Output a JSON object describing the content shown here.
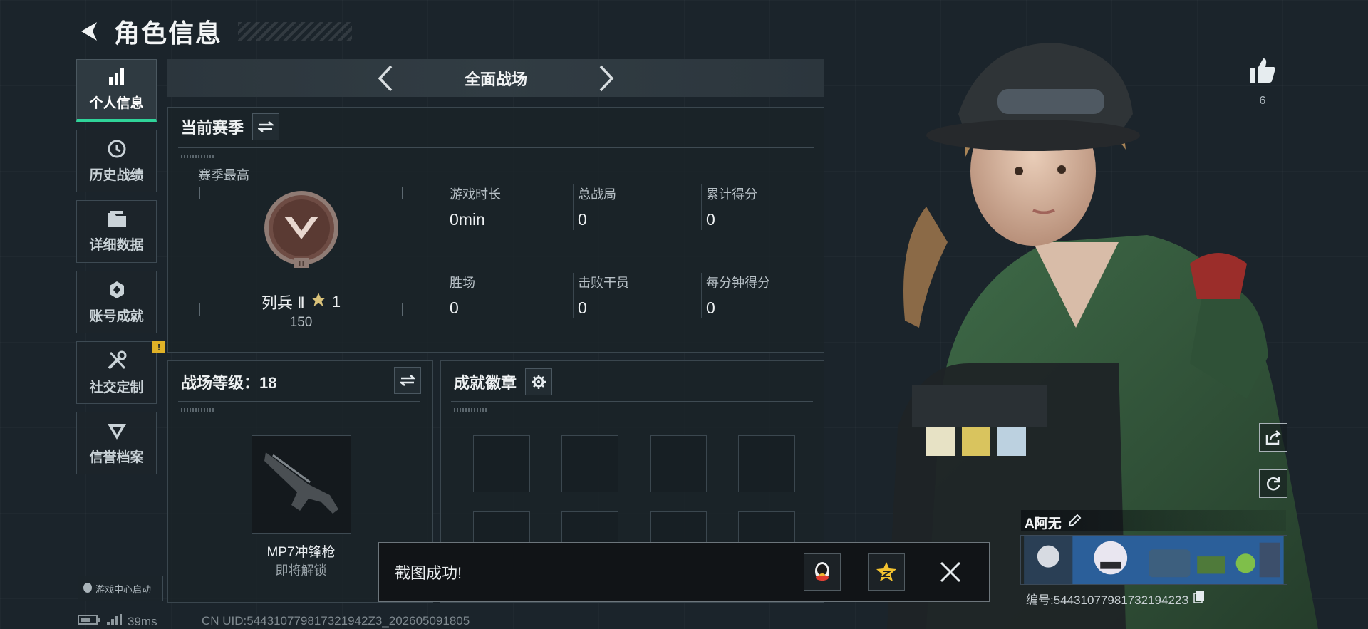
{
  "header": {
    "title": "角色信息"
  },
  "sidebar": {
    "items": [
      {
        "label": "个人信息",
        "icon": "bar-chart-icon",
        "active": true
      },
      {
        "label": "历史战绩",
        "icon": "history-icon"
      },
      {
        "label": "详细数据",
        "icon": "folder-icon"
      },
      {
        "label": "账号成就",
        "icon": "achievement-icon"
      },
      {
        "label": "社交定制",
        "icon": "tools-icon",
        "badge": "!"
      },
      {
        "label": "信誉档案",
        "icon": "reputation-icon"
      }
    ],
    "game_center": "游戏中心启动"
  },
  "mode_bar": {
    "title": "全面战场"
  },
  "season": {
    "title": "当前赛季",
    "best_label": "赛季最高",
    "rank_name": "列兵 Ⅱ",
    "rank_stars": "1",
    "rank_score": "150",
    "stats": [
      {
        "label": "游戏时长",
        "value": "0min"
      },
      {
        "label": "总战局",
        "value": "0"
      },
      {
        "label": "累计得分",
        "value": "0"
      },
      {
        "label": "胜场",
        "value": "0"
      },
      {
        "label": "击败干员",
        "value": "0"
      },
      {
        "label": "每分钟得分",
        "value": "0"
      }
    ]
  },
  "level": {
    "title": "战场等级：18",
    "weapon_name": "MP7冲锋枪",
    "weapon_status": "即将解锁"
  },
  "badges": {
    "title": "成就徽章"
  },
  "toast": {
    "message": "截图成功!"
  },
  "like": {
    "count": "6"
  },
  "player": {
    "name": "A阿无",
    "id": "编号:5443107798173219422З"
  },
  "status": {
    "ping": "39ms",
    "uid": "CN UID:544310779817321942Z3_202605091805"
  },
  "colors": {
    "accent": "#2fd49a",
    "background": "#1b242b",
    "badge": "#e0b227"
  }
}
